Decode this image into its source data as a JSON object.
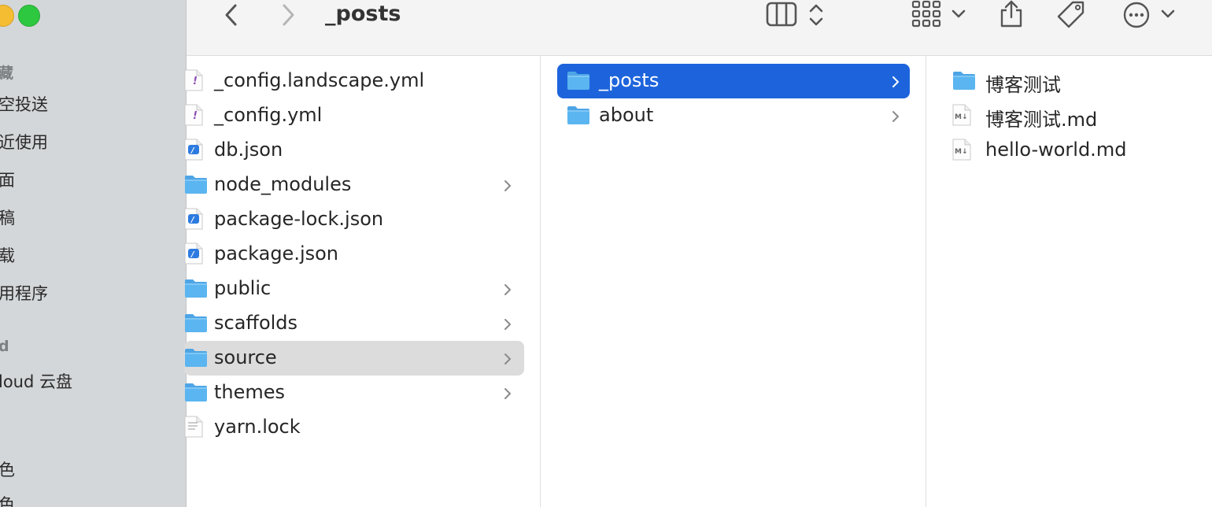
{
  "window": {
    "title": "_posts"
  },
  "sidebar": {
    "favorites_header": "藏",
    "items": [
      "空投送",
      "近使用",
      "面",
      "稿",
      "载",
      "用程序"
    ],
    "locations_header": "d",
    "icloud": "loud 云盘",
    "tags": [
      "色",
      "色"
    ]
  },
  "toolbar": {
    "back": "back-icon",
    "forward": "forward-icon",
    "view": "column-view-icon",
    "group": "grid-group-icon",
    "share": "share-icon",
    "tag": "tag-icon",
    "more": "more-icon"
  },
  "column1": [
    {
      "name": "_config.landscape.yml",
      "kind": "yml",
      "folder": false
    },
    {
      "name": "_config.yml",
      "kind": "yml",
      "folder": false
    },
    {
      "name": "db.json",
      "kind": "json",
      "folder": false
    },
    {
      "name": "node_modules",
      "kind": "folder",
      "folder": true
    },
    {
      "name": "package-lock.json",
      "kind": "json",
      "folder": false
    },
    {
      "name": "package.json",
      "kind": "json",
      "folder": false
    },
    {
      "name": "public",
      "kind": "folder",
      "folder": true
    },
    {
      "name": "scaffolds",
      "kind": "folder",
      "folder": true
    },
    {
      "name": "source",
      "kind": "folder",
      "folder": true,
      "selected": true
    },
    {
      "name": "themes",
      "kind": "folder",
      "folder": true
    },
    {
      "name": "yarn.lock",
      "kind": "text",
      "folder": false
    }
  ],
  "column2": [
    {
      "name": "_posts",
      "kind": "folder",
      "folder": true,
      "selected": true
    },
    {
      "name": "about",
      "kind": "folder",
      "folder": true
    }
  ],
  "column3": [
    {
      "name": "博客测试",
      "kind": "folder",
      "folder": true
    },
    {
      "name": "博客测试.md",
      "kind": "md",
      "folder": false
    },
    {
      "name": "hello-world.md",
      "kind": "md",
      "folder": false
    }
  ],
  "colors": {
    "accent": "#1d64dc",
    "folder": "#5bb5f0",
    "sidebar": "#d4d7d9"
  }
}
